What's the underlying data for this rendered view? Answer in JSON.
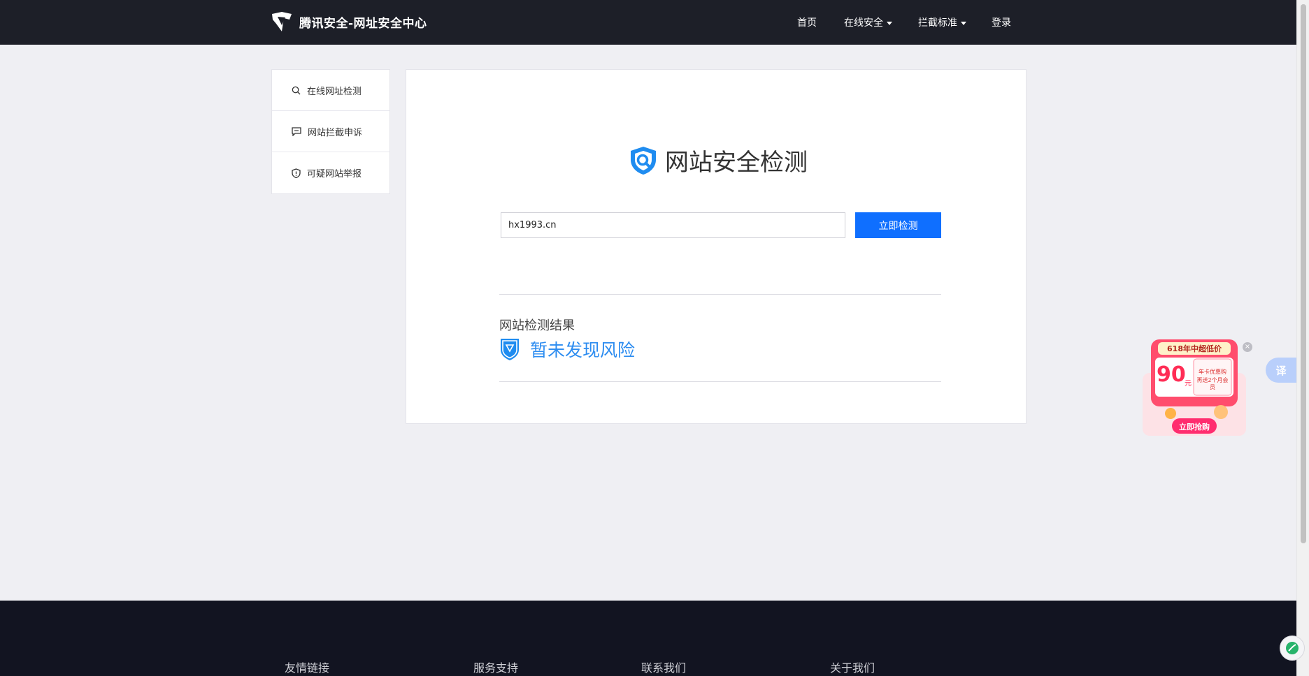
{
  "header": {
    "title": "腾讯安全-网址安全中心",
    "nav": [
      {
        "label": "首页",
        "has_dropdown": false
      },
      {
        "label": "在线安全",
        "has_dropdown": true
      },
      {
        "label": "拦截标准",
        "has_dropdown": true
      },
      {
        "label": "登录",
        "has_dropdown": false
      }
    ]
  },
  "sidebar": {
    "items": [
      {
        "label": "在线网址检测",
        "icon": "search-icon"
      },
      {
        "label": "网站拦截申诉",
        "icon": "message-icon"
      },
      {
        "label": "可疑网站举报",
        "icon": "shield-icon"
      }
    ]
  },
  "main": {
    "title": "网站安全检测",
    "search": {
      "value": "hx1993.cn",
      "placeholder": ""
    },
    "button_label": "立即检测",
    "result_label": "网站检测结果",
    "result_status": "暂未发现风险"
  },
  "promo": {
    "tag": "618年中超低价",
    "price": "90",
    "unit": "元",
    "line1": "年卡优惠购",
    "line2": "再送2个月会员",
    "cta": "立即抢购"
  },
  "translate": {
    "label": "译"
  },
  "footer": {
    "columns": [
      "友情链接",
      "服务支持",
      "联系我们",
      "关于我们"
    ]
  },
  "colors": {
    "header_bg": "#1d1f28",
    "accent": "#0f6fff",
    "result": "#2c8cf0",
    "footer_bg": "#121421"
  }
}
